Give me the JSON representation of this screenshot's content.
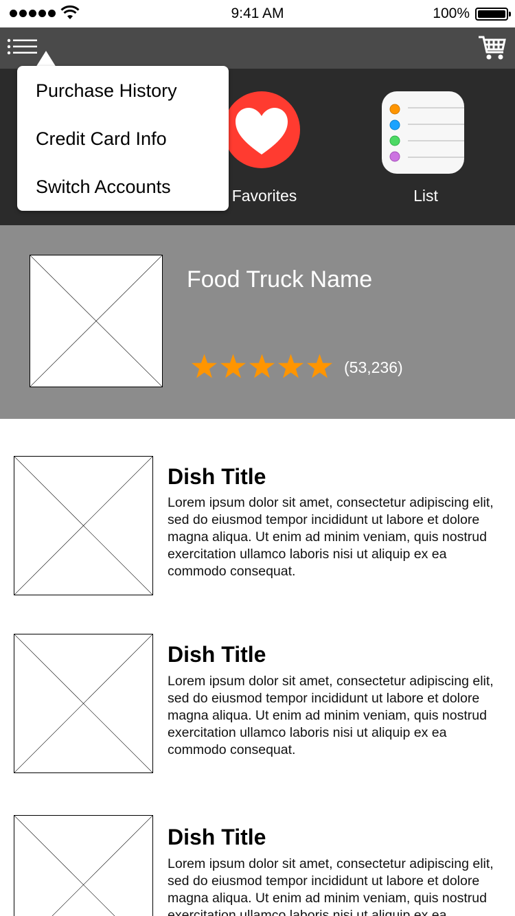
{
  "status_bar": {
    "time": "9:41 AM",
    "battery_percent": "100%",
    "signal_icon": "signal-dots-icon",
    "wifi_icon": "wifi-icon",
    "battery_icon": "battery-icon",
    "battery_level": 1.0
  },
  "nav": {
    "menu_icon": "menu-list-icon",
    "cart_icon": "shopping-cart-icon"
  },
  "categories": [
    {
      "label": "Favorites",
      "icon": "heart-icon",
      "color": "#ff3b30"
    },
    {
      "label": "List",
      "icon": "reminders-list-icon"
    }
  ],
  "dropdown": {
    "items": [
      {
        "label": "Purchase History"
      },
      {
        "label": "Credit Card Info"
      },
      {
        "label": "Switch Accounts"
      }
    ]
  },
  "truck": {
    "name": "Food Truck Name",
    "rating": 5,
    "rating_max": 5,
    "review_count": "(53,236)",
    "star_color": "#ff9500"
  },
  "dishes": [
    {
      "title": "Dish Title",
      "description": "Lorem ipsum dolor sit amet, consectetur adipiscing elit, sed do eiusmod tempor incididunt ut labore et dolore magna aliqua. Ut enim ad minim veniam, quis nostrud exercitation ullamco laboris nisi ut aliquip ex ea commodo consequat."
    },
    {
      "title": "Dish Title",
      "description": "Lorem ipsum dolor sit amet, consectetur adipiscing elit, sed do eiusmod tempor incididunt ut labore et dolore magna aliqua. Ut enim ad minim veniam, quis nostrud exercitation ullamco laboris nisi ut aliquip ex ea commodo consequat."
    },
    {
      "title": "Dish Title",
      "description": "Lorem ipsum dolor sit amet, consectetur adipiscing elit, sed do eiusmod tempor incididunt ut labore et dolore magna aliqua. Ut enim ad minim veniam, quis nostrud exercitation ullamco laboris nisi ut aliquip ex ea commodo consequat."
    }
  ],
  "colors": {
    "nav_bg": "#4a4a4a",
    "category_bg": "#2b2b2b",
    "truck_bg": "#8c8c8c"
  }
}
